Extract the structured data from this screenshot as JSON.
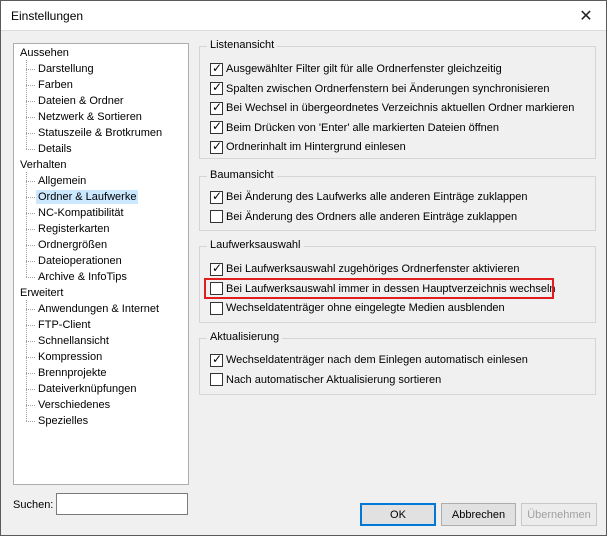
{
  "window": {
    "title": "Einstellungen",
    "close_glyph": "✕"
  },
  "tree": {
    "groups": [
      {
        "label": "Aussehen",
        "children": [
          "Darstellung",
          "Farben",
          "Dateien & Ordner",
          "Netzwerk & Sortieren",
          "Statuszeile & Brotkrumen",
          "Details"
        ]
      },
      {
        "label": "Verhalten",
        "children": [
          "Allgemein",
          "Ordner & Laufwerke",
          "NC-Kompatibilität",
          "Registerkarten",
          "Ordnergrößen",
          "Dateioperationen",
          "Archive & InfoTips"
        ]
      },
      {
        "label": "Erweitert",
        "children": [
          "Anwendungen & Internet",
          "FTP-Client",
          "Schnellansicht",
          "Kompression",
          "Brennprojekte",
          "Dateiverknüpfungen",
          "Verschiedenes",
          "Spezielles"
        ]
      }
    ],
    "selected": "Ordner & Laufwerke"
  },
  "search": {
    "label": "Suchen:",
    "value": ""
  },
  "sections": [
    {
      "title": "Listenansicht",
      "options": [
        {
          "label": "Ausgewählter Filter gilt für alle Ordnerfenster gleichzeitig",
          "checked": true
        },
        {
          "label": "Spalten zwischen Ordnerfenstern bei Änderungen synchronisieren",
          "checked": true
        },
        {
          "label": "Bei Wechsel in übergeordnetes Verzeichnis aktuellen Ordner markieren",
          "checked": true
        },
        {
          "label": "Beim Drücken von 'Enter' alle markierten Dateien öffnen",
          "checked": true
        },
        {
          "label": "Ordnerinhalt im Hintergrund einlesen",
          "checked": true
        }
      ]
    },
    {
      "title": "Baumansicht",
      "options": [
        {
          "label": "Bei Änderung des Laufwerks alle anderen Einträge zuklappen",
          "checked": true
        },
        {
          "label": "Bei Änderung des Ordners alle anderen Einträge zuklappen",
          "checked": false
        }
      ]
    },
    {
      "title": "Laufwerksauswahl",
      "options": [
        {
          "label": "Bei Laufwerksauswahl zugehöriges Ordnerfenster aktivieren",
          "checked": true
        },
        {
          "label": "Bei Laufwerksauswahl immer in dessen Hauptverzeichnis wechseln",
          "checked": false
        },
        {
          "label": "Wechseldatenträger ohne eingelegte Medien ausblenden",
          "checked": false
        }
      ]
    },
    {
      "title": "Aktualisierung",
      "options": [
        {
          "label": "Wechseldatenträger nach dem Einlegen automatisch einlesen",
          "checked": true
        },
        {
          "label": "Nach automatischer Aktualisierung sortieren",
          "checked": false
        }
      ]
    }
  ],
  "buttons": {
    "ok": "OK",
    "cancel": "Abbrechen",
    "apply": "Übernehmen"
  },
  "colors": {
    "highlight": "#e01e1e",
    "selection": "#cce8ff",
    "default_button_border": "#0078d7"
  }
}
